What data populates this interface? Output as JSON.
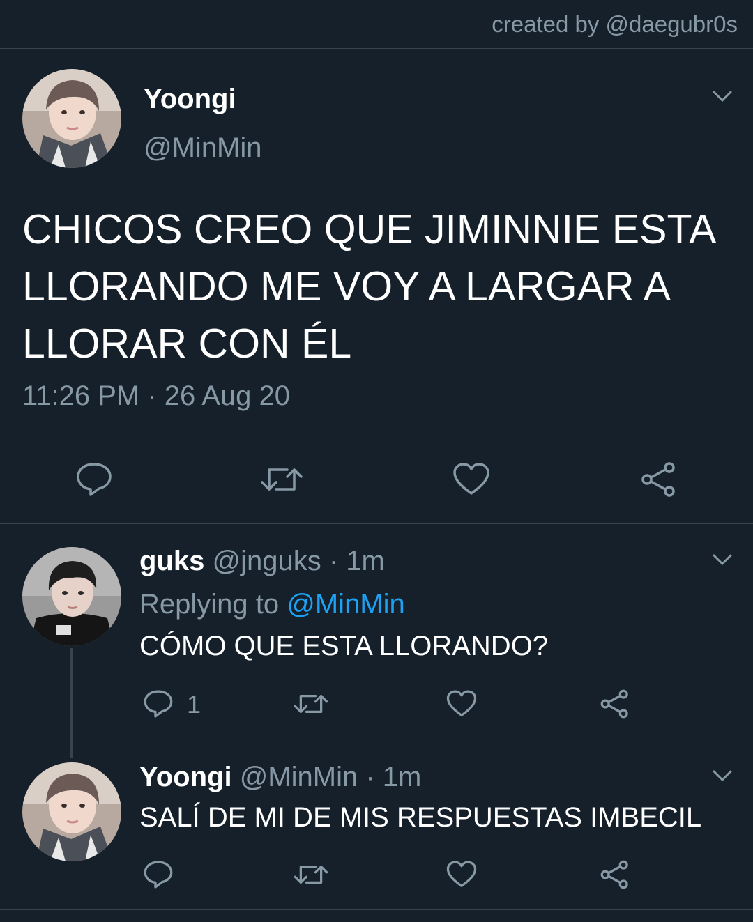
{
  "credit": "created by @daegubr0s",
  "main_tweet": {
    "display_name": "Yoongi",
    "handle": "@MinMin",
    "text_lines": [
      "CHICOS CREO QUE JIMINNIE ESTA",
      "LLORANDO ME VOY A LARGAR A",
      "LLORAR CON ÉL"
    ],
    "timestamp": "11:26 PM · 26 Aug 20",
    "avatar_icon": "avatar-yoongi"
  },
  "reply1": {
    "display_name": "guks",
    "handle": "@jnguks",
    "time": "· 1m",
    "replying_label": "Replying to",
    "replying_handle": "@MinMin",
    "text": "CÓMO QUE ESTA LLORANDO?",
    "reply_count": "1",
    "avatar_icon": "avatar-guks"
  },
  "reply2": {
    "display_name": "Yoongi",
    "handle": "@MinMin",
    "time": "· 1m",
    "text": "SALÍ DE MI DE MIS RESPUESTAS IMBECIL",
    "avatar_icon": "avatar-yoongi"
  },
  "icons": {
    "reply": "reply-icon",
    "retweet": "retweet-icon",
    "like": "heart-icon",
    "share": "share-icon",
    "menu": "chevron-down-icon"
  },
  "colors": {
    "background": "#15202b",
    "muted": "#8899a6",
    "link": "#1da1f2",
    "divider": "#38444d"
  }
}
